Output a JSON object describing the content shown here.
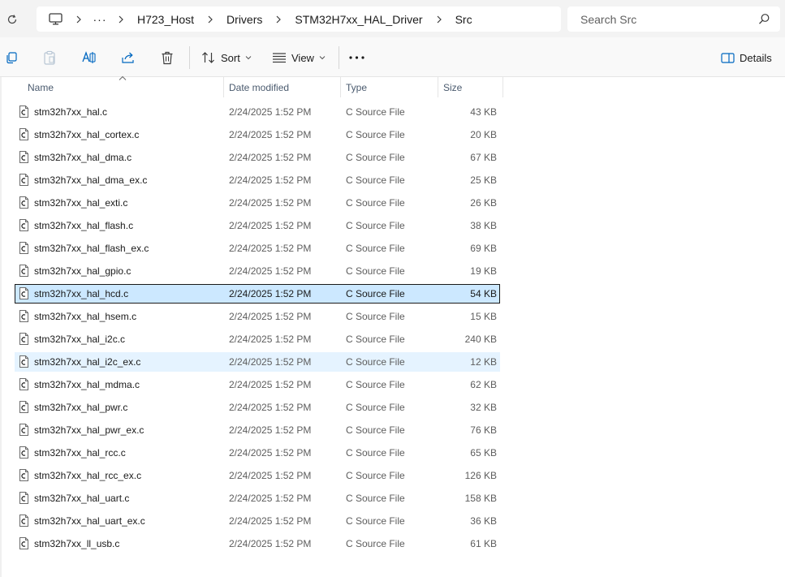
{
  "address": {
    "crumbs": [
      "H723_Host",
      "Drivers",
      "STM32H7xx_HAL_Driver",
      "Src"
    ]
  },
  "search": {
    "placeholder": "Search Src"
  },
  "commands": {
    "sort_label": "Sort",
    "view_label": "View",
    "details_label": "Details"
  },
  "columns": {
    "name": "Name",
    "date": "Date modified",
    "type": "Type",
    "size": "Size"
  },
  "files": [
    {
      "name": "stm32h7xx_hal.c",
      "date": "2/24/2025 1:52 PM",
      "type": "C Source File",
      "size": "43 KB"
    },
    {
      "name": "stm32h7xx_hal_cortex.c",
      "date": "2/24/2025 1:52 PM",
      "type": "C Source File",
      "size": "20 KB"
    },
    {
      "name": "stm32h7xx_hal_dma.c",
      "date": "2/24/2025 1:52 PM",
      "type": "C Source File",
      "size": "67 KB"
    },
    {
      "name": "stm32h7xx_hal_dma_ex.c",
      "date": "2/24/2025 1:52 PM",
      "type": "C Source File",
      "size": "25 KB"
    },
    {
      "name": "stm32h7xx_hal_exti.c",
      "date": "2/24/2025 1:52 PM",
      "type": "C Source File",
      "size": "26 KB"
    },
    {
      "name": "stm32h7xx_hal_flash.c",
      "date": "2/24/2025 1:52 PM",
      "type": "C Source File",
      "size": "38 KB"
    },
    {
      "name": "stm32h7xx_hal_flash_ex.c",
      "date": "2/24/2025 1:52 PM",
      "type": "C Source File",
      "size": "69 KB"
    },
    {
      "name": "stm32h7xx_hal_gpio.c",
      "date": "2/24/2025 1:52 PM",
      "type": "C Source File",
      "size": "19 KB"
    },
    {
      "name": "stm32h7xx_hal_hcd.c",
      "date": "2/24/2025 1:52 PM",
      "type": "C Source File",
      "size": "54 KB"
    },
    {
      "name": "stm32h7xx_hal_hsem.c",
      "date": "2/24/2025 1:52 PM",
      "type": "C Source File",
      "size": "15 KB"
    },
    {
      "name": "stm32h7xx_hal_i2c.c",
      "date": "2/24/2025 1:52 PM",
      "type": "C Source File",
      "size": "240 KB"
    },
    {
      "name": "stm32h7xx_hal_i2c_ex.c",
      "date": "2/24/2025 1:52 PM",
      "type": "C Source File",
      "size": "12 KB"
    },
    {
      "name": "stm32h7xx_hal_mdma.c",
      "date": "2/24/2025 1:52 PM",
      "type": "C Source File",
      "size": "62 KB"
    },
    {
      "name": "stm32h7xx_hal_pwr.c",
      "date": "2/24/2025 1:52 PM",
      "type": "C Source File",
      "size": "32 KB"
    },
    {
      "name": "stm32h7xx_hal_pwr_ex.c",
      "date": "2/24/2025 1:52 PM",
      "type": "C Source File",
      "size": "76 KB"
    },
    {
      "name": "stm32h7xx_hal_rcc.c",
      "date": "2/24/2025 1:52 PM",
      "type": "C Source File",
      "size": "65 KB"
    },
    {
      "name": "stm32h7xx_hal_rcc_ex.c",
      "date": "2/24/2025 1:52 PM",
      "type": "C Source File",
      "size": "126 KB"
    },
    {
      "name": "stm32h7xx_hal_uart.c",
      "date": "2/24/2025 1:52 PM",
      "type": "C Source File",
      "size": "158 KB"
    },
    {
      "name": "stm32h7xx_hal_uart_ex.c",
      "date": "2/24/2025 1:52 PM",
      "type": "C Source File",
      "size": "36 KB"
    },
    {
      "name": "stm32h7xx_ll_usb.c",
      "date": "2/24/2025 1:52 PM",
      "type": "C Source File",
      "size": "61 KB"
    }
  ],
  "selected_file": "stm32h7xx_hal_hcd.c",
  "hovered_file": "stm32h7xx_hal_i2c_ex.c",
  "colors": {
    "selection": "#cce8ff",
    "hover": "#e5f3ff",
    "accent": "#0067c0"
  }
}
